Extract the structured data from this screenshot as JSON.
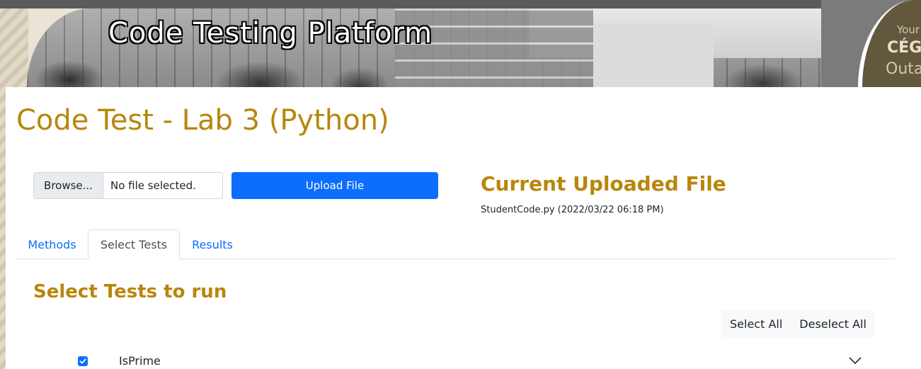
{
  "header": {
    "banner_title": "Code Testing Platform",
    "logo_line1": "Your",
    "logo_line2": "CÉG",
    "logo_line3": "Outa"
  },
  "page": {
    "title": "Code Test - Lab 3 (Python)"
  },
  "upload": {
    "browse_label": "Browse...",
    "file_status": "No file selected.",
    "upload_label": "Upload File"
  },
  "current_file": {
    "heading": "Current Uploaded File",
    "info": "StudentCode.py (2022/03/22 06:18 PM)"
  },
  "tabs": [
    {
      "label": "Methods",
      "active": false
    },
    {
      "label": "Select Tests",
      "active": true
    },
    {
      "label": "Results",
      "active": false
    }
  ],
  "select_tests": {
    "heading": "Select Tests to run",
    "select_all_label": "Select All",
    "deselect_all_label": "Deselect All",
    "tests": [
      {
        "name": "IsPrime",
        "checked": true
      }
    ]
  },
  "colors": {
    "accent_gold": "#b8860b",
    "primary_blue": "#0d6efd",
    "logo_brown": "#62583d"
  },
  "icons": {
    "checkbox": "check-icon",
    "expand": "chevron-down-icon"
  }
}
